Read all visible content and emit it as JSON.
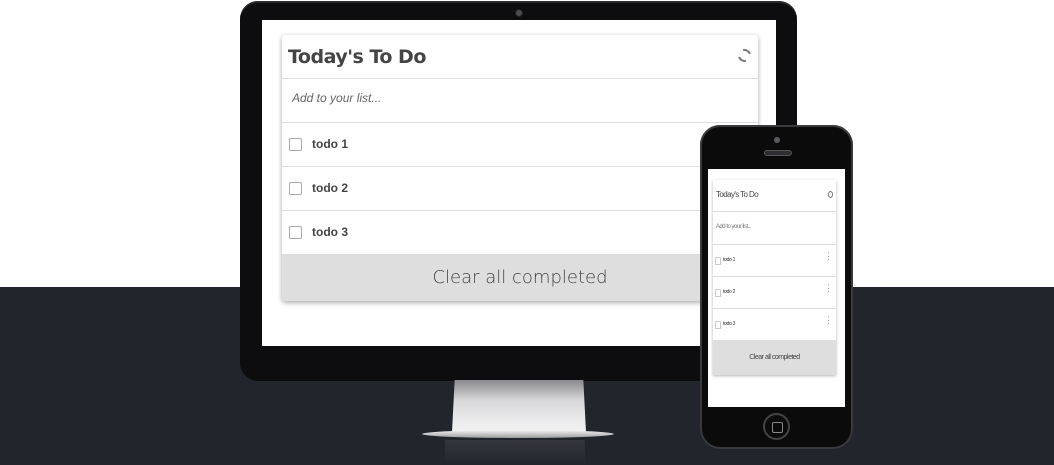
{
  "app": {
    "title": "Today's To Do",
    "add_placeholder": "Add to your list...",
    "todos": [
      {
        "label": "todo 1",
        "checked": false
      },
      {
        "label": "todo 2",
        "checked": false
      },
      {
        "label": "todo 3",
        "checked": false
      }
    ],
    "clear_label": "Clear all completed",
    "refresh_icon": "refresh-icon",
    "menu_icon": "more-vertical-icon"
  },
  "colors": {
    "page_top": "#ffffff",
    "page_bottom": "#23252d",
    "device_frame": "#0d0d0f",
    "clear_button_bg": "#dedede",
    "text": "#444444"
  }
}
